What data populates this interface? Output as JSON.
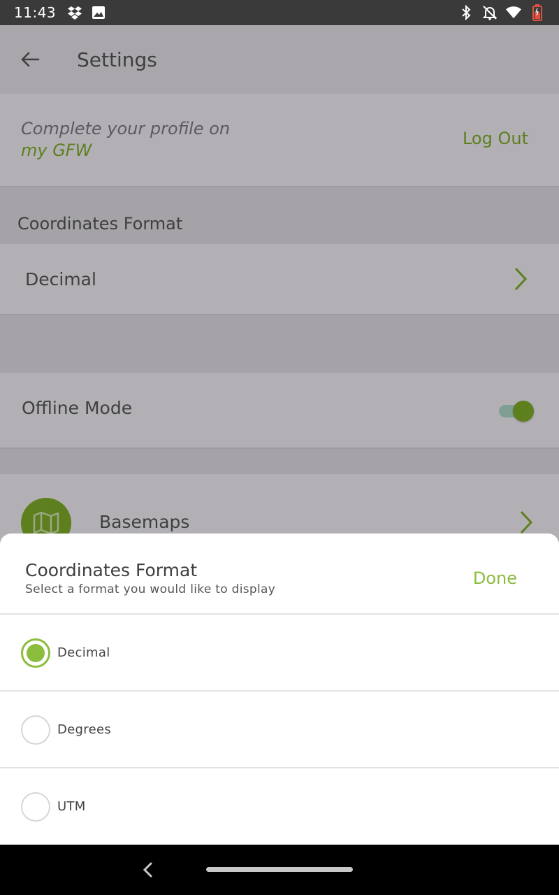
{
  "status_bar": {
    "time": "11:43",
    "left_icons": [
      "dropbox-icon",
      "image-icon"
    ],
    "right_icons": [
      "bluetooth-icon",
      "notifications-off-icon",
      "wifi-icon",
      "battery-icon"
    ]
  },
  "toolbar": {
    "title": "Settings"
  },
  "profile": {
    "line1": "Complete your profile on",
    "line2": "my GFW",
    "logout": "Log Out"
  },
  "coordinates_section": {
    "header": "Coordinates Format",
    "value": "Decimal"
  },
  "offline": {
    "label": "Offline Mode",
    "enabled": true
  },
  "basemaps": {
    "label": "Basemaps"
  },
  "sheet": {
    "title": "Coordinates Format",
    "subtitle": "Select a format you would like to display",
    "done": "Done",
    "options": [
      {
        "label": "Decimal",
        "selected": true
      },
      {
        "label": "Degrees",
        "selected": false
      },
      {
        "label": "UTM",
        "selected": false
      }
    ]
  },
  "colors": {
    "accent": "#8bbd3f",
    "accent_dark": "#5d7f1e",
    "scrim": "#b2b0b4"
  }
}
